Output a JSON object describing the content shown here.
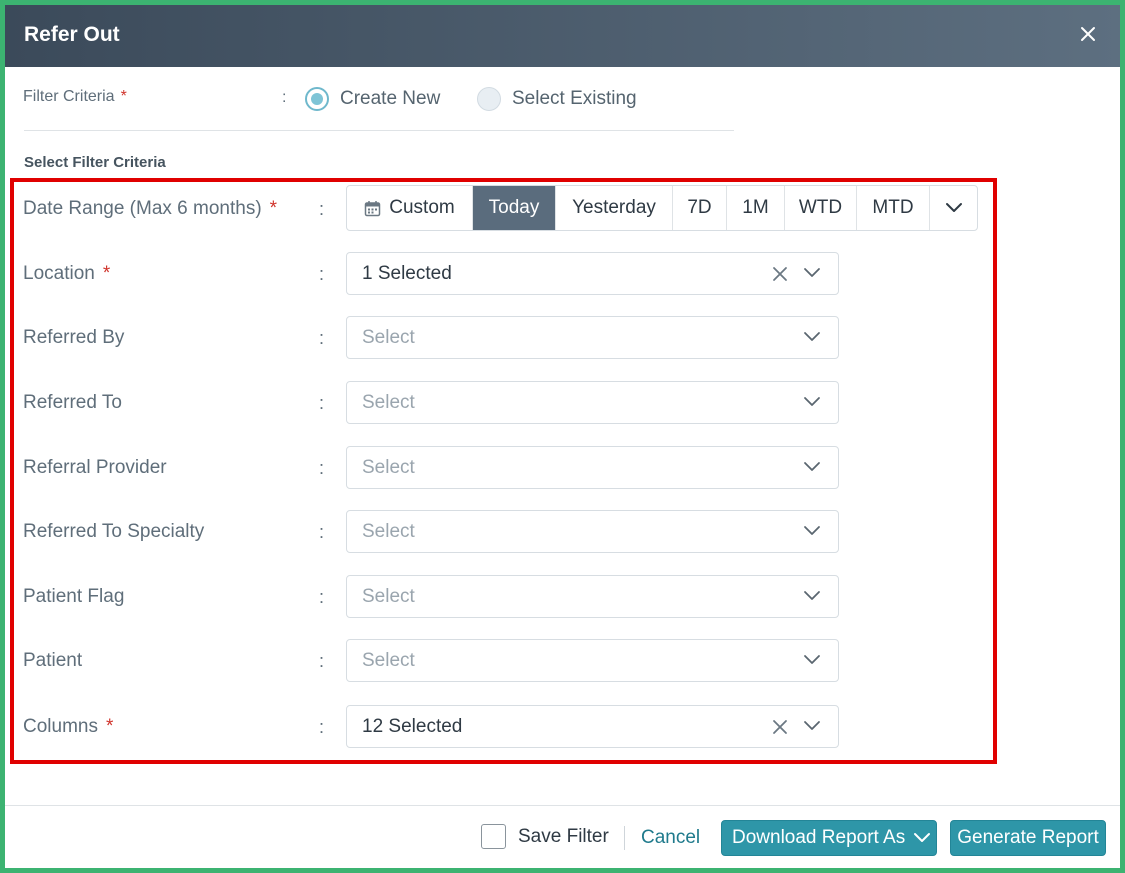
{
  "dialog": {
    "title": "Refer Out",
    "close_icon": "close-icon"
  },
  "filter_criteria": {
    "label": "Filter Criteria",
    "required_mark": "*",
    "colon": ":",
    "options": [
      {
        "label": "Create New",
        "selected": true
      },
      {
        "label": "Select Existing",
        "selected": false
      }
    ]
  },
  "section_title": "Select Filter Criteria",
  "date_range": {
    "label": "Date Range (Max 6 months)",
    "required_mark": "*",
    "colon": ":",
    "segments": [
      "Custom",
      "Today",
      "Yesterday",
      "7D",
      "1M",
      "WTD",
      "MTD"
    ],
    "active": "Today",
    "calendar_icon": "calendar-icon",
    "more_icon": "chevron-down-icon"
  },
  "fields": [
    {
      "label": "Location",
      "required_mark": "*",
      "value": "1 Selected",
      "clearable": true
    },
    {
      "label": "Referred By",
      "required_mark": "",
      "value": "Select",
      "clearable": false
    },
    {
      "label": "Referred To",
      "required_mark": "",
      "value": "Select",
      "clearable": false
    },
    {
      "label": "Referral Provider",
      "required_mark": "",
      "value": "Select",
      "clearable": false
    },
    {
      "label": "Referred To Specialty",
      "required_mark": "",
      "value": "Select",
      "clearable": false
    },
    {
      "label": "Patient Flag",
      "required_mark": "",
      "value": "Select",
      "clearable": false
    },
    {
      "label": "Patient",
      "required_mark": "",
      "value": "Select",
      "clearable": false
    },
    {
      "label": "Columns",
      "required_mark": "*",
      "value": "12 Selected",
      "clearable": true
    }
  ],
  "field_colon": ":",
  "footer": {
    "save_filter_label": "Save Filter",
    "save_filter_checked": false,
    "cancel_label": "Cancel",
    "download_label": "Download Report As",
    "generate_label": "Generate Report"
  },
  "colors": {
    "header_start": "#3b4a5a",
    "header_end": "#5d6f80",
    "accent": "#2e96a8",
    "active_segment": "#5a6c7d",
    "required": "#d0342c",
    "highlight_border": "#e00000",
    "outer_border": "#3cb371"
  }
}
